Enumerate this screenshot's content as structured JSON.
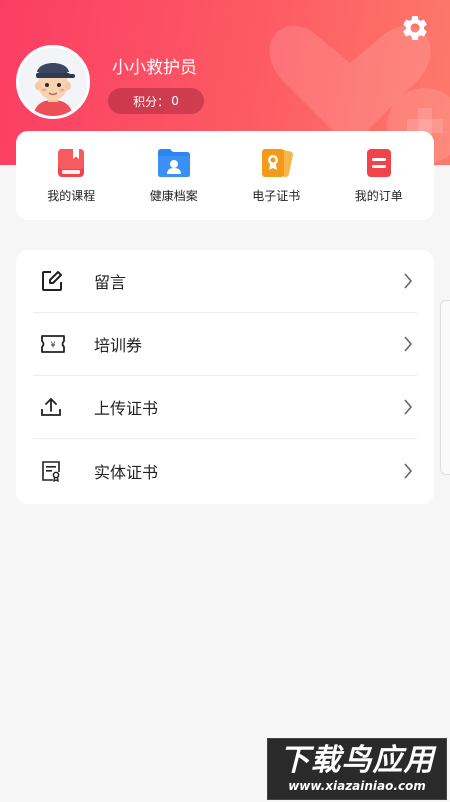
{
  "colors": {
    "header_gradient_start": "#fb3d64",
    "header_gradient_end": "#fd7a6b",
    "course_icon": "#f2434b",
    "health_icon": "#2e84f0",
    "certificate_icon": "#f39a1a",
    "order_icon": "#f2434b"
  },
  "header": {
    "username": "小小救护员",
    "points_label": "积分：",
    "points_value": "0",
    "settings_icon": "gear-icon"
  },
  "quick_links": [
    {
      "label": "我的课程",
      "icon": "book-icon"
    },
    {
      "label": "健康档案",
      "icon": "health-folder-icon"
    },
    {
      "label": "电子证书",
      "icon": "certificate-icon"
    },
    {
      "label": "我的订单",
      "icon": "order-icon"
    }
  ],
  "menu": [
    {
      "label": "留言",
      "icon": "edit-icon"
    },
    {
      "label": "培训券",
      "icon": "ticket-icon"
    },
    {
      "label": "上传证书",
      "icon": "upload-icon"
    },
    {
      "label": "实体证书",
      "icon": "document-certificate-icon"
    }
  ],
  "watermark": {
    "title": "下载鸟应用",
    "url": "www.xiazainiao.com"
  }
}
